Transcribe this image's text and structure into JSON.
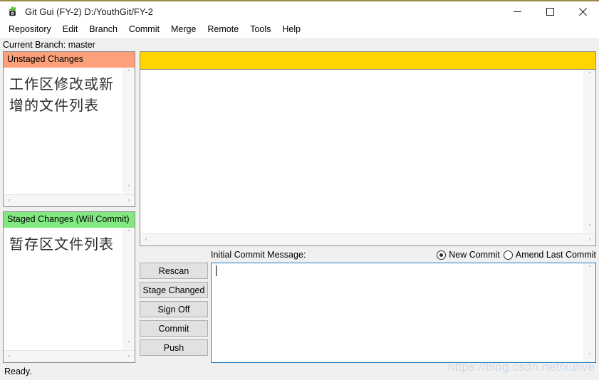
{
  "window": {
    "title": "Git Gui (FY-2) D:/YouthGit/FY-2",
    "icon": "git-gui-icon",
    "minimize_label": "—",
    "maximize_label": "☐",
    "close_label": "✕"
  },
  "menubar": {
    "items": [
      {
        "label": "Repository"
      },
      {
        "label": "Edit"
      },
      {
        "label": "Branch"
      },
      {
        "label": "Commit"
      },
      {
        "label": "Merge"
      },
      {
        "label": "Remote"
      },
      {
        "label": "Tools"
      },
      {
        "label": "Help"
      }
    ]
  },
  "branch": {
    "line": "Current Branch: master"
  },
  "panes": {
    "unstaged": {
      "header": "Unstaged Changes",
      "header_color": "#fca07a",
      "content": "工作区修改或新增的文件列表"
    },
    "staged": {
      "header": "Staged Changes (Will Commit)",
      "header_color": "#82e881",
      "content": "暂存区文件列表"
    },
    "diff": {
      "banner_color": "#ffd400",
      "content": ""
    }
  },
  "commit": {
    "message_label": "Initial Commit Message:",
    "message_value": "",
    "options": [
      {
        "label": "New Commit",
        "checked": true
      },
      {
        "label": "Amend Last Commit",
        "checked": false
      }
    ]
  },
  "buttons": [
    {
      "label": "Rescan"
    },
    {
      "label": "Stage Changed"
    },
    {
      "label": "Sign Off"
    },
    {
      "label": "Commit"
    },
    {
      "label": "Push"
    }
  ],
  "statusbar": {
    "text": "Ready."
  },
  "watermark": {
    "text": "https://blog.csdn.net/xulive"
  },
  "scrollbars": {
    "up": "˄",
    "down": "˅",
    "left": "‹",
    "right": "›"
  }
}
